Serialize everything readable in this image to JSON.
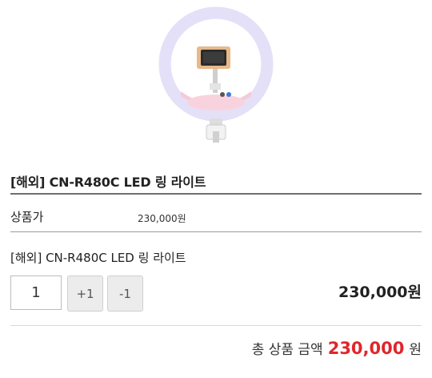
{
  "product": {
    "title": "[해외] CN-R480C LED 링 라이트",
    "price_label": "상품가",
    "price_value": "230,000원",
    "option_name": "[해외] CN-R480C LED 링 라이트"
  },
  "quantity": {
    "value": "1",
    "plus_label": "+1",
    "minus_label": "-1",
    "line_total": "230,000원"
  },
  "summary": {
    "total_label": "총 상품 금액",
    "total_amount": "230,000",
    "total_unit": "원"
  },
  "colors": {
    "accent": "#e0262b",
    "ring_light": "#e9e6fa",
    "button_bg": "#ececec"
  },
  "icons": {
    "product_image": "ring-light-product-image"
  }
}
